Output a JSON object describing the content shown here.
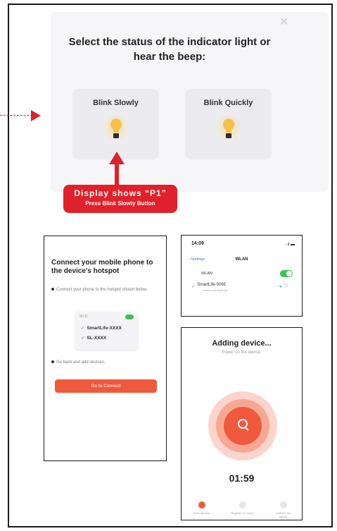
{
  "top_panel": {
    "title": "Select the status of the indicator light or hear the beep:",
    "close_glyph": "✕",
    "options": [
      {
        "label": "Blink Slowly",
        "icon": "lightbulb-icon"
      },
      {
        "label": "Blink Quickly",
        "icon": "lightbulb-icon"
      }
    ]
  },
  "annotation": {
    "line1": "Display shows “P1”",
    "line2": "Press Blink Slowly Button",
    "color": "#e0212b"
  },
  "connect_screen": {
    "heading": "Connect your mobile phone to the device's hotspot",
    "step1": "Connect your phone to the hotspot shown below.",
    "wifi_header": "Wi-Fi",
    "networks": [
      "SmartLife-XXXX",
      "SL-XXXX"
    ],
    "step2": "Go back and add devices.",
    "button": "Go to Connect",
    "accent": "#ef5a3c"
  },
  "wlan_screen": {
    "time": "14:09",
    "status": "..ıl ▬",
    "back": "‹ Settings",
    "title": "WLAN",
    "wlan_label": "WLAN",
    "network": "SmartLife-5065",
    "network_sub": "Unsecured Network",
    "icons": "ᯤ ⓘ"
  },
  "adding_screen": {
    "title": "Adding device...",
    "subtitle": "Power on the device.",
    "timer": "01:59",
    "steps": [
      "Scan devices.",
      "Register on Cloud.",
      "Initialize the device."
    ]
  }
}
